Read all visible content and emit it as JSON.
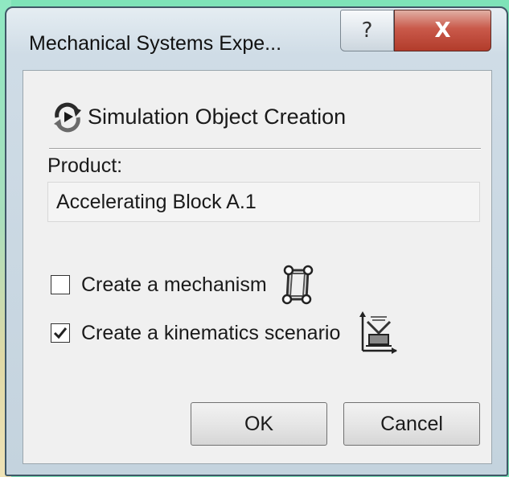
{
  "window": {
    "title": "Mechanical Systems Expe...",
    "help_glyph": "?",
    "close_glyph": "X"
  },
  "section": {
    "title": "Simulation Object Creation",
    "icon": "simulation-object-icon"
  },
  "product": {
    "label": "Product:",
    "value": "Accelerating Block A.1"
  },
  "options": [
    {
      "label": "Create a mechanism",
      "checked": false,
      "icon": "mechanism-icon"
    },
    {
      "label": "Create a kinematics scenario",
      "checked": true,
      "icon": "kinematics-scenario-icon"
    }
  ],
  "buttons": {
    "ok": "OK",
    "cancel": "Cancel"
  },
  "colors": {
    "desktop": "#7ee3b8",
    "close_button": "#c9594a",
    "dialog_face": "#f0f0f0"
  }
}
